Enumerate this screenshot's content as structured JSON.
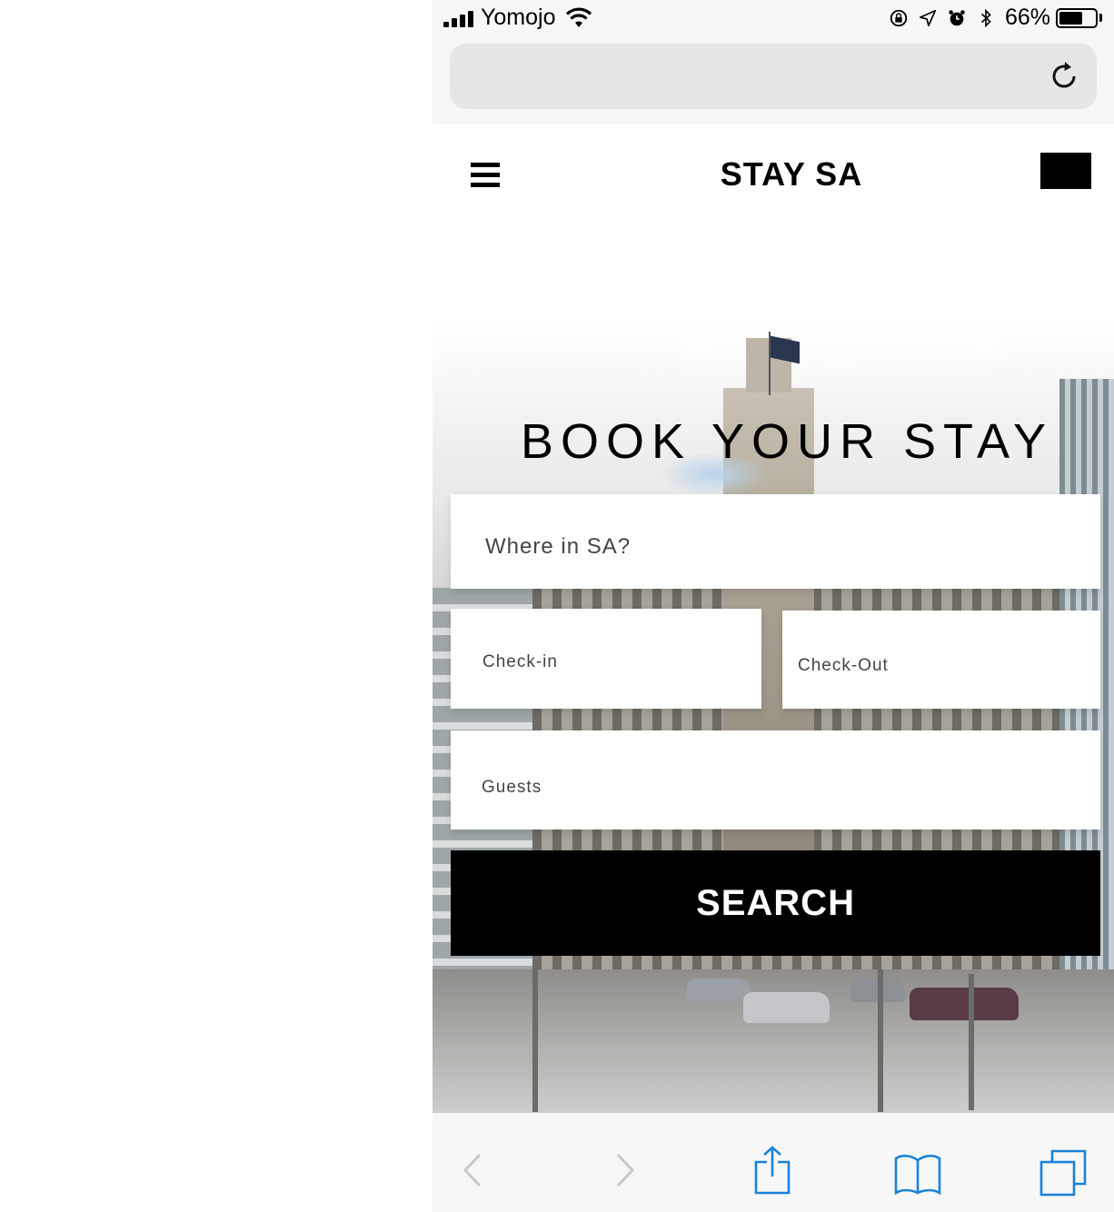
{
  "status_bar": {
    "carrier": "Yomojo",
    "battery": "66%",
    "battery_level": 0.66
  },
  "browser": {
    "url_text": "",
    "reload_icon": "reload-icon"
  },
  "nav": {
    "menu_icon": "hamburger-menu-icon",
    "brand": "STAY SA"
  },
  "hero": {
    "headline": "BOOK YOUR STAY"
  },
  "form": {
    "where_placeholder": "Where in SA?",
    "checkin_placeholder": "Check-in",
    "checkout_placeholder": "Check-Out",
    "guests_placeholder": "Guests",
    "search_label": "SEARCH"
  },
  "toolbar": {
    "icons": [
      "back-icon",
      "forward-icon",
      "share-icon",
      "bookmarks-icon",
      "tabs-icon"
    ]
  },
  "colors": {
    "accent": "#000000",
    "ios_blue": "#1a82d8",
    "field_bg": "#ffffff"
  }
}
